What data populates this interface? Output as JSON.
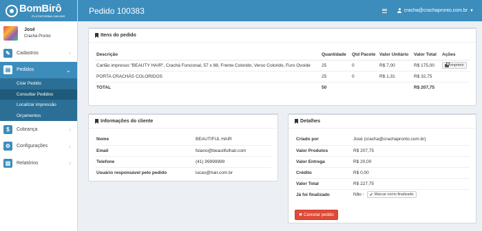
{
  "brand": {
    "name": "BomBirô",
    "tagline": "PLATAFORMA ONLINE"
  },
  "user": {
    "name": "José",
    "company": "Crachá Pronto"
  },
  "header": {
    "title": "Pedido 100383",
    "email": "cracha@crachapronto.com.br"
  },
  "sidebar": {
    "items": [
      {
        "label": "Cadastros"
      },
      {
        "label": "Pedidos"
      },
      {
        "label": "Cobrança"
      },
      {
        "label": "Configurações"
      },
      {
        "label": "Relatórios"
      }
    ],
    "pedidos_sub": [
      {
        "label": "Criar Pedido"
      },
      {
        "label": "Consultar Pedidos"
      },
      {
        "label": "Localizar impressão"
      },
      {
        "label": "Orçamentos"
      }
    ]
  },
  "items_box": {
    "title": "Itens do pedido",
    "columns": [
      "Descrição",
      "Quantidade",
      "Qtd Pacote",
      "Valor Unitário",
      "Valor Total",
      "Ações"
    ],
    "rows": [
      [
        "Cartão impresso \"BEAUTY HAIR\", Crachá Funcional, 57 x 88, Frente Colorido, Verso Colorido, Furo Ovoide",
        "25",
        "0",
        "R$ 7,00",
        "R$ 175,00",
        "imprimir"
      ],
      [
        "PORTA CRACHÁS COLORIDOS",
        "25",
        "0",
        "R$ 1,31",
        "R$ 32,75",
        ""
      ]
    ],
    "total": {
      "label": "TOTAL",
      "quantity": "50",
      "value": "R$ 207,75"
    }
  },
  "client_box": {
    "title": "Informações do cliente",
    "rows": [
      {
        "key": "Nome",
        "value": "BEAUTIFUL HAIR"
      },
      {
        "key": "Email",
        "value": "fulano@beautifulhair.com"
      },
      {
        "key": "Telefone",
        "value": "(41) 99999999"
      },
      {
        "key": "Usuário responsável pelo pedido",
        "value": "lucas@hair.com.br"
      }
    ]
  },
  "details_box": {
    "title": "Detalhes",
    "rows": [
      {
        "key": "Criado por",
        "value": "José (cracha@crachapronto.com.br)"
      },
      {
        "key": "Valor Produtos",
        "value": "R$ 207,75"
      },
      {
        "key": "Valor Entrega",
        "value": "R$ 20,00"
      },
      {
        "key": "Crédito",
        "value": "R$ 0,00"
      },
      {
        "key": "Valor Total",
        "value": "R$ 227,75"
      },
      {
        "key": "Já foi finalizado",
        "value": "Não -"
      }
    ],
    "mark_label": "Marcar como finalizado",
    "cancel_label": "Cancelar pedido"
  },
  "colors": {
    "primary": "#3c8dbc",
    "danger": "#dd4b39"
  }
}
